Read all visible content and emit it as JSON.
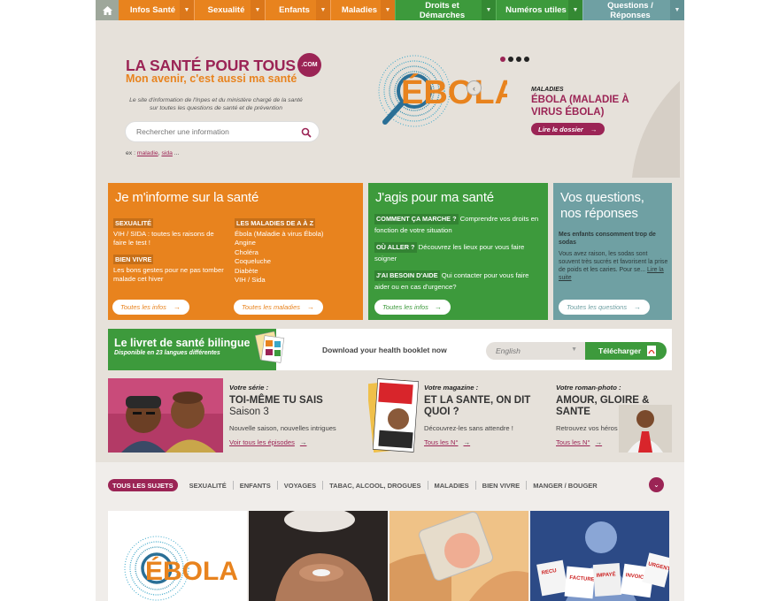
{
  "nav": {
    "items": [
      {
        "label": "Infos Santé",
        "color": "#e8831e"
      },
      {
        "label": "Sexualité",
        "color": "#e8831e"
      },
      {
        "label": "Enfants",
        "color": "#e8831e"
      },
      {
        "label": "Maladies",
        "color": "#e8831e"
      },
      {
        "label": "Droits et Démarches",
        "color": "#3d9a3c"
      },
      {
        "label": "Numéros utiles",
        "color": "#3d9a3c"
      },
      {
        "label": "Questions / Réponses",
        "color": "#6fa0a3"
      }
    ]
  },
  "header": {
    "logo_title": "LA SANTÉ POUR TOUS",
    "logo_suffix": ".COM",
    "logo_tagline": "Mon avenir, c'est aussi ma santé",
    "description": "Le site d'information de l'Inpes et du ministère chargé de la santé sur toutes les questions de santé et de prévention",
    "search_placeholder": "Rechercher une information",
    "examples_prefix": "ex : ",
    "example1": "maladie",
    "example_sep": ", ",
    "example2": "sida",
    "examples_suffix": " ..."
  },
  "slider": {
    "category": "MALADIES",
    "title": "ÉBOLA (MALADIE À VIRUS ÉBOLA)",
    "button": "Lire le dossier",
    "arrow": "→",
    "logo_text": "ÉBOLA",
    "total_slides": 4,
    "active_slide": 1
  },
  "box_info": {
    "title": "Je m'informe sur la santé",
    "tag1": "SEXUALITÉ",
    "text1": "VIH / SIDA : toutes les raisons de faire le test !",
    "tag2": "BIEN VIVRE",
    "text2": "Les bons gestes pour ne pas tomber malade cet hiver",
    "tag3": "LES MALADIES DE A À Z",
    "diseases": [
      "Ébola (Maladie à virus Ébola)",
      "Angine",
      "Choléra",
      "Coqueluche",
      "Diabète",
      "VIH / Sida"
    ],
    "btn1": "Toutes les infos",
    "btn2": "Toutes les maladies",
    "color": "#e8831e"
  },
  "box_act": {
    "title": "J'agis pour ma santé",
    "tag1": "COMMENT ÇA MARCHE ?",
    "text1": "Comprendre vos droits en fonction de votre situation",
    "tag2": "OÙ ALLER ?",
    "text2": "Découvrez les lieux pour vous faire soigner",
    "tag3": "J'AI BESOIN D'AIDE",
    "text3": "Qui contacter pour vous faire aider ou en cas d'urgence?",
    "btn": "Toutes les infos",
    "color": "#3d9a3c"
  },
  "box_qa": {
    "title": "Vos questions, nos réponses",
    "question": "Mes enfants consomment trop de sodas",
    "answer": "Vous avez raison, les sodas sont souvent très sucrés et favorisent la prise de poids et les caries. Pour se...",
    "more": "Lire la suite",
    "btn": "Toutes les questions",
    "color": "#6fa0a3"
  },
  "booklet": {
    "title": "Le livret de santé bilingue",
    "subtitle": "Disponible en 23 langues différentes",
    "cta": "Download your health booklet now",
    "language": "English",
    "button": "Télécharger"
  },
  "cards": [
    {
      "label": "Votre série :",
      "title": "TOI-MÊME TU SAIS",
      "title2": "Saison 3",
      "text": "Nouvelle saison, nouvelles intrigues",
      "link": "Voir tous les épisodes"
    },
    {
      "label": "Votre magazine :",
      "title": "ET LA SANTE, ON DIT QUOI ?",
      "text": "Découvrez-les sans attendre !",
      "link": "Tous les N°"
    },
    {
      "label": "Votre roman-photo :",
      "title": "AMOUR, GLOIRE & SANTE",
      "text": "Retrouvez vos héros !",
      "link": "Tous les N°"
    }
  ],
  "filters": [
    "TOUS LES SUJETS",
    "SEXUALITÉ",
    "ENFANTS",
    "VOYAGES",
    "TABAC, ALCOOL, DROGUES",
    "MALADIES",
    "BIEN VIVRE",
    "MANGER / BOUGER"
  ],
  "tiles": {
    "ebola_text": "ÉBOLA",
    "bill_labels": [
      "FACTURE",
      "INVOICE",
      "IMPAYÉ",
      "URGENT",
      "RECU"
    ]
  }
}
